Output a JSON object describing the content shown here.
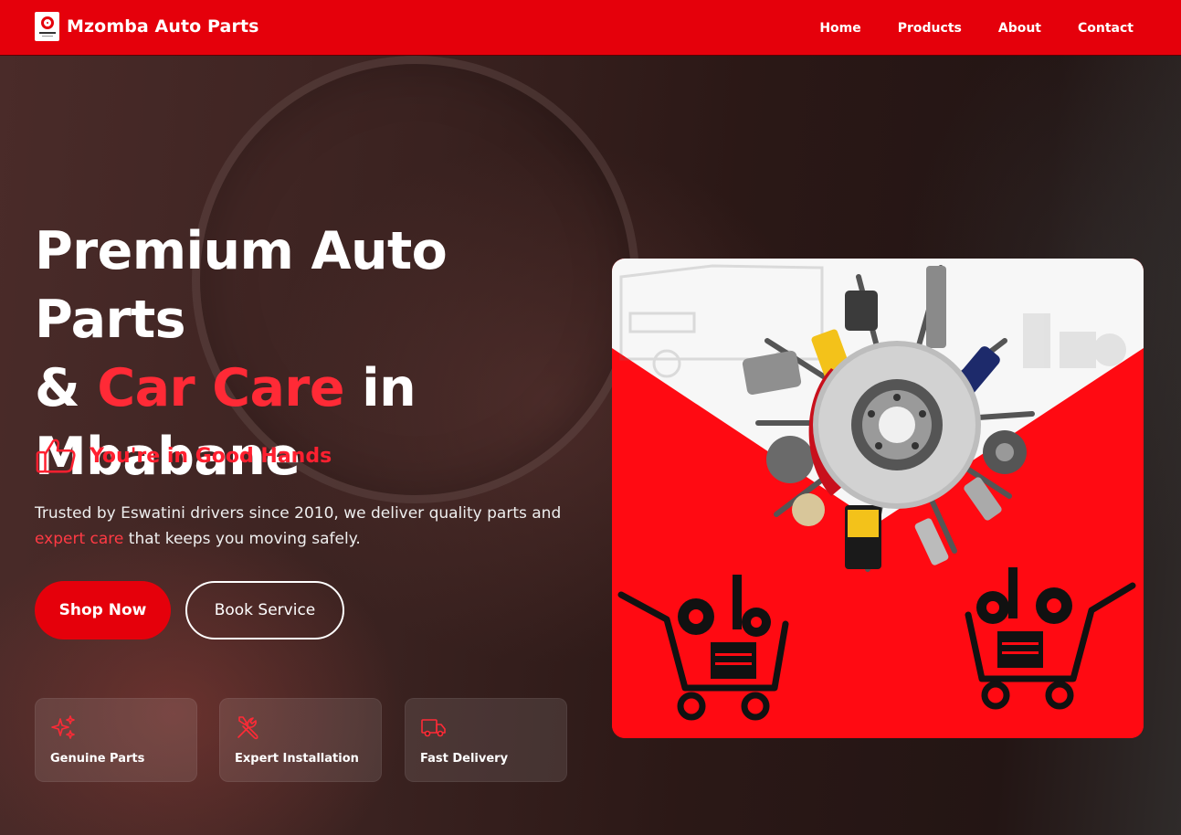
{
  "brand": {
    "name": "Mzomba Auto Parts",
    "logo_icon": "brand-logo-icon",
    "accent": "#e5000b"
  },
  "nav": {
    "items": [
      {
        "label": "Home"
      },
      {
        "label": "Products"
      },
      {
        "label": "About"
      },
      {
        "label": "Contact"
      }
    ]
  },
  "hero": {
    "title_line1": "Premium Auto Parts",
    "title_amp": "&",
    "title_accent": "Car Care",
    "title_in": "in",
    "title_line3": "Mbabane",
    "tagline": "You're in Good Hands",
    "tagline_icon": "thumbs-up-icon",
    "desc_part1": "Trusted by Eswatini drivers since 2010, we deliver quality parts and",
    "desc_accent": "expert care",
    "desc_part2": "that keeps you moving safely.",
    "shop_label": "Shop Now",
    "book_label": "Book Service"
  },
  "features": [
    {
      "label": "Genuine Parts",
      "icon": "sparkles-icon"
    },
    {
      "label": "Expert Installation",
      "icon": "wrench-screwdriver-icon"
    },
    {
      "label": "Fast Delivery",
      "icon": "truck-icon"
    }
  ],
  "colors": {
    "primary": "#e5000b",
    "accent_text": "#ff2a36",
    "background": "#2a1816"
  }
}
